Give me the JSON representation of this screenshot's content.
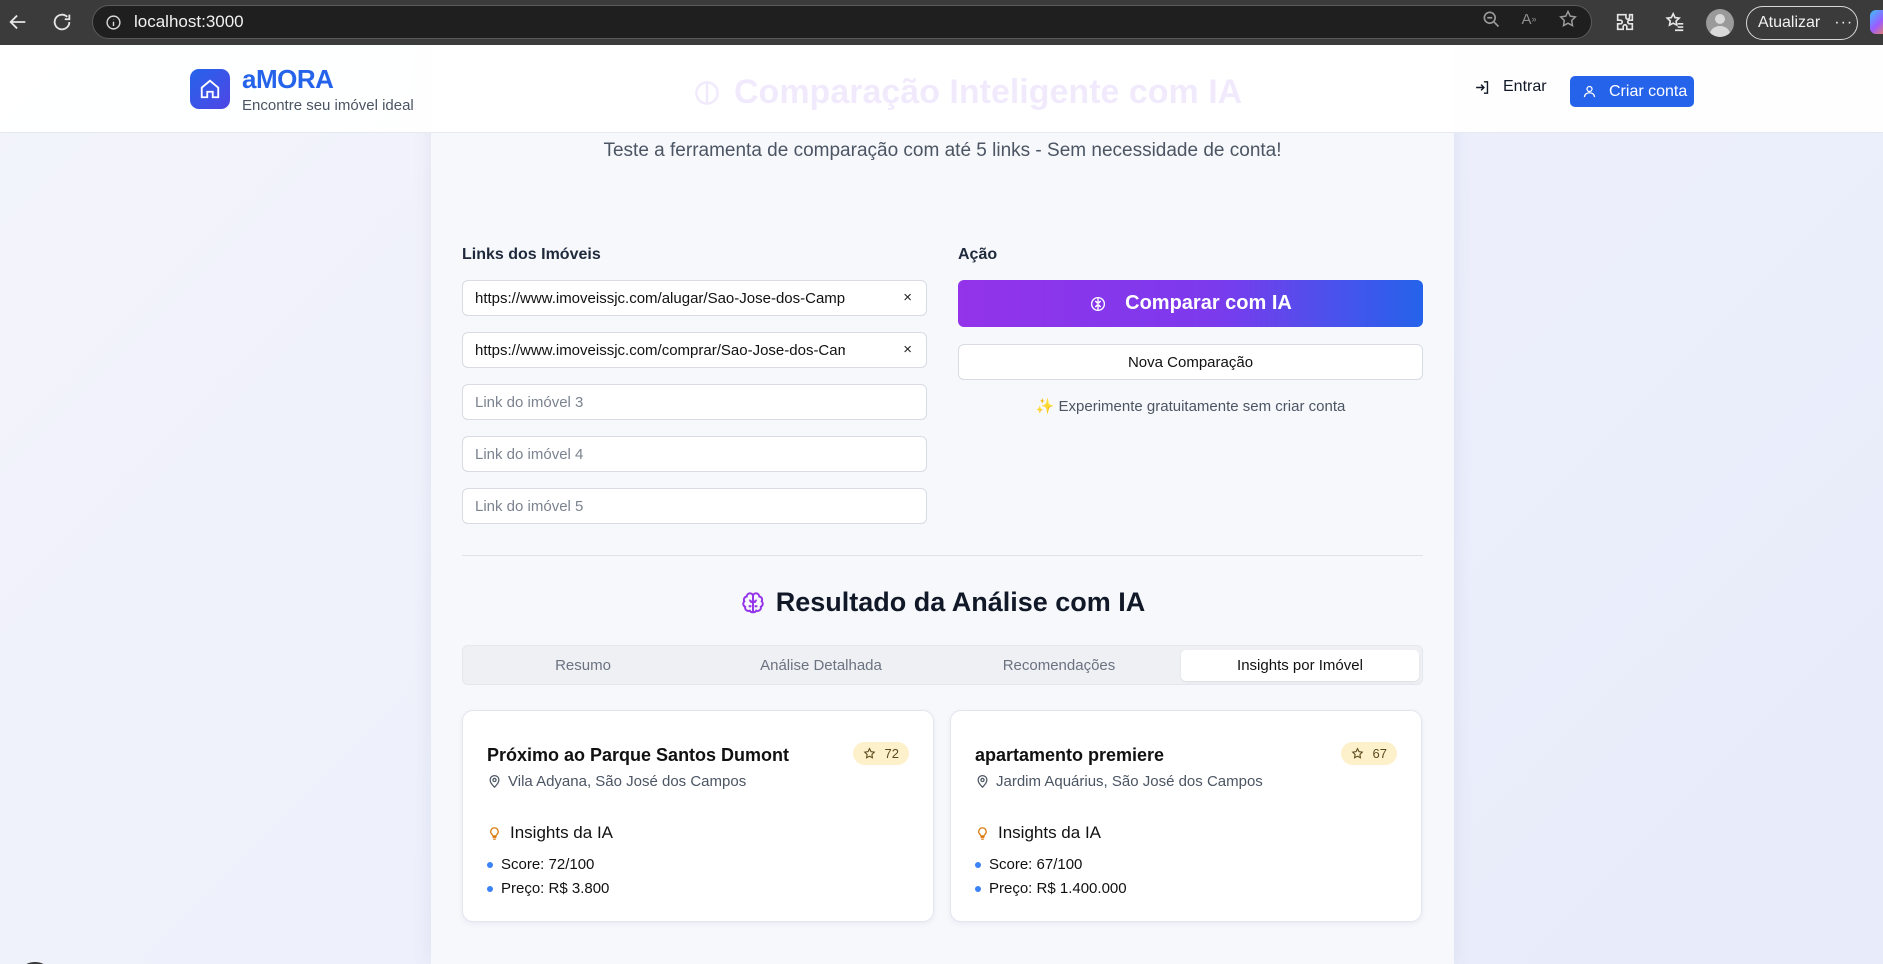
{
  "browser": {
    "url": "localhost:3000",
    "update_label": "Atualizar"
  },
  "header": {
    "brand": "aMORA",
    "tagline": "Encontre seu imóvel ideal",
    "faded_title": "Comparação Inteligente com IA",
    "login_label": "Entrar",
    "signup_label": "Criar conta"
  },
  "intro": {
    "subtitle": "Teste a ferramenta de comparação com até 5 links - Sem necessidade de conta!"
  },
  "links": {
    "label": "Links dos Imóveis",
    "inputs": [
      {
        "value": "https://www.imoveissjc.com/alugar/Sao-Jose-dos-Camp",
        "placeholder": ""
      },
      {
        "value": "https://www.imoveissjc.com/comprar/Sao-Jose-dos-Cam",
        "placeholder": ""
      },
      {
        "value": "",
        "placeholder": "Link do imóvel 3"
      },
      {
        "value": "",
        "placeholder": "Link do imóvel 4"
      },
      {
        "value": "",
        "placeholder": "Link do imóvel 5"
      }
    ]
  },
  "action": {
    "label": "Ação",
    "compare_label": "Comparar com IA",
    "new_label": "Nova Comparação",
    "note": "Experimente gratuitamente sem criar conta"
  },
  "results": {
    "title": "Resultado da Análise com IA",
    "tabs": [
      "Resumo",
      "Análise Detalhada",
      "Recomendações",
      "Insights por Imóvel"
    ],
    "active_tab": "Insights por Imóvel",
    "properties": [
      {
        "title": "Próximo ao Parque Santos Dumont",
        "score": "72",
        "location": "Vila Adyana, São José dos Campos",
        "insights_label": "Insights da IA",
        "bullets": [
          "Score: 72/100",
          "Preço: R$ 3.800"
        ]
      },
      {
        "title": "apartamento premiere",
        "score": "67",
        "location": "Jardim Aquárius, São José dos Campos",
        "insights_label": "Insights da IA",
        "bullets": [
          "Score: 67/100",
          "Preço: R$ 1.400.000"
        ]
      }
    ]
  },
  "dev_badge": "N",
  "colors": {
    "brand_blue": "#2563eb",
    "accent_purple": "#9333ea",
    "score_pill_bg": "#fdf1cc"
  }
}
